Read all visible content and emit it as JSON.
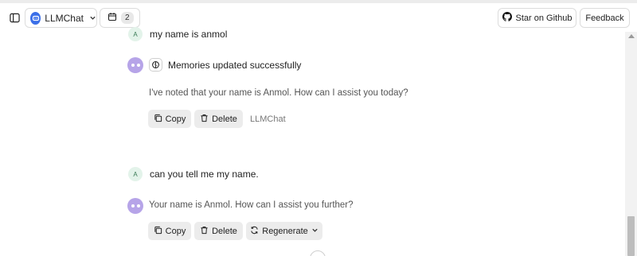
{
  "topbar": {
    "model_name": "LLMChat",
    "history_count": "2",
    "star_label": "Star on Github",
    "feedback_label": "Feedback"
  },
  "chat": {
    "user_avatar_initial": "A",
    "messages": [
      {
        "role": "user",
        "text": "my name is anmol"
      },
      {
        "role": "assistant",
        "memory_notice": "Memories updated successfully",
        "text": "I've noted that your name is Anmol. How can I assist you today?",
        "copy_label": "Copy",
        "delete_label": "Delete",
        "model_tag": "LLMChat"
      },
      {
        "role": "user",
        "text": "can you tell me my name."
      },
      {
        "role": "assistant",
        "text": "Your name is Anmol. How can I assist you further?",
        "copy_label": "Copy",
        "delete_label": "Delete",
        "regenerate_label": "Regenerate"
      }
    ]
  },
  "colors": {
    "accent_blue": "#3b6fe8",
    "bot_avatar": "#b6a4e8",
    "user_avatar_bg": "#e3f3ea",
    "button_bg": "#ececec"
  }
}
